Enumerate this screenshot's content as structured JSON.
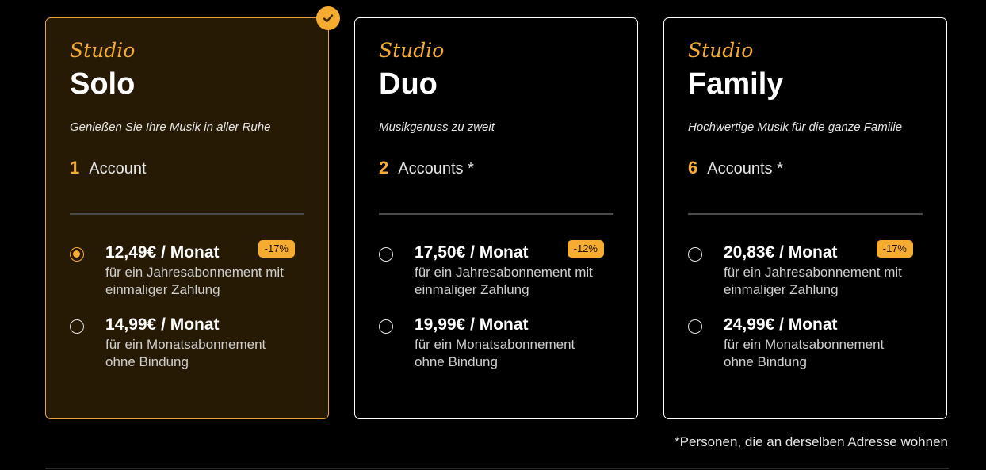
{
  "plans": [
    {
      "brand": "Studio",
      "name": "Solo",
      "tagline": "Genießen Sie Ihre Musik in aller Ruhe",
      "account_count": "1",
      "account_label": "Account",
      "selected": true,
      "options": [
        {
          "price": "12,49€ / Monat",
          "description": "für ein Jahresabonnement mit einmaliger Zahlung",
          "discount": "-17%",
          "checked": true
        },
        {
          "price": "14,99€ / Monat",
          "description": "für ein Monatsabonnement ohne Bindung",
          "checked": false
        }
      ]
    },
    {
      "brand": "Studio",
      "name": "Duo",
      "tagline": "Musikgenuss zu zweit",
      "account_count": "2",
      "account_label": "Accounts *",
      "selected": false,
      "options": [
        {
          "price": "17,50€ / Monat",
          "description": "für ein Jahresabonnement mit einmaliger Zahlung",
          "discount": "-12%",
          "checked": false
        },
        {
          "price": "19,99€ / Monat",
          "description": "für ein Monatsabonnement ohne Bindung",
          "checked": false
        }
      ]
    },
    {
      "brand": "Studio",
      "name": "Family",
      "tagline": "Hochwertige Musik für die ganze Familie",
      "account_count": "6",
      "account_label": "Accounts *",
      "selected": false,
      "options": [
        {
          "price": "20,83€ / Monat",
          "description": "für ein Jahresabonnement mit einmaliger Zahlung",
          "discount": "-17%",
          "checked": false
        },
        {
          "price": "24,99€ / Monat",
          "description": "für ein Monatsabonnement ohne Bindung",
          "checked": false
        }
      ]
    }
  ],
  "footnote": "*Personen, die an derselben Adresse wohnen",
  "icons": {
    "selected_badge": "checkmark-icon",
    "radio": "radio-button"
  },
  "colors": {
    "accent": "#f6ab31",
    "selected_card_bg": "#261a05",
    "background": "#000000"
  }
}
